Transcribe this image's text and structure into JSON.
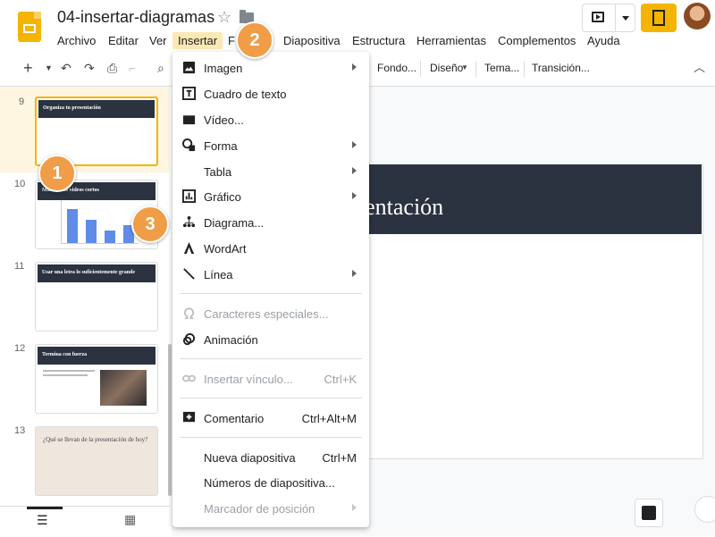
{
  "app": {
    "doc_title": "04-insertar-diagramas"
  },
  "menubar": {
    "items": [
      "Archivo",
      "Editar",
      "Ver",
      "Insertar",
      "F",
      "Diapositiva",
      "Estructura",
      "Herramientas",
      "Complementos",
      "Ayuda"
    ]
  },
  "toolbar": {
    "items": [
      "Fondo...",
      "Diseño",
      "Tema...",
      "Transición..."
    ]
  },
  "filmstrip": {
    "slides": [
      {
        "num": "9",
        "title": "Organiza tu presentación"
      },
      {
        "num": "10",
        "title": "Mantén tus videos cortos"
      },
      {
        "num": "11",
        "title": "Usar una letra lo suficientemente grande"
      },
      {
        "num": "12",
        "title": "Termina con fuerza"
      },
      {
        "num": "13",
        "title": "¿Qué se llevan de la presentación de hoy?"
      }
    ]
  },
  "canvas": {
    "slide_title_visible": "sentación"
  },
  "insert_menu": {
    "items": [
      {
        "label": "Imagen",
        "icon": "image-icon",
        "submenu": true
      },
      {
        "label": "Cuadro de texto",
        "icon": "text-box-icon"
      },
      {
        "label": "Vídeo...",
        "icon": "video-icon"
      },
      {
        "label": "Forma",
        "icon": "shape-icon",
        "submenu": true
      },
      {
        "label": "Tabla",
        "submenu": true
      },
      {
        "label": "Gráfico",
        "icon": "chart-icon",
        "submenu": true
      },
      {
        "label": "Diagrama...",
        "icon": "diagram-icon"
      },
      {
        "label": "WordArt",
        "icon": "wordart-icon"
      },
      {
        "label": "Línea",
        "icon": "line-icon",
        "submenu": true
      },
      {
        "label": "Caracteres especiales...",
        "icon": "omega-icon",
        "disabled": true
      },
      {
        "label": "Animación",
        "icon": "animation-icon"
      },
      {
        "label": "Insertar vínculo...",
        "icon": "link-icon",
        "shortcut": "Ctrl+K",
        "disabled": true
      },
      {
        "label": "Comentario",
        "icon": "comment-icon",
        "shortcut": "Ctrl+Alt+M"
      },
      {
        "label": "Nueva diapositiva",
        "shortcut": "Ctrl+M"
      },
      {
        "label": "Números de diapositiva..."
      },
      {
        "label": "Marcador de posición",
        "submenu": true,
        "disabled": true
      }
    ]
  },
  "callouts": [
    "1",
    "2",
    "3"
  ],
  "colors": {
    "accent": "#f4b400",
    "callout": "#f09d47",
    "slide_header": "#2b3240",
    "menu_highlight": "#fce8b2"
  }
}
